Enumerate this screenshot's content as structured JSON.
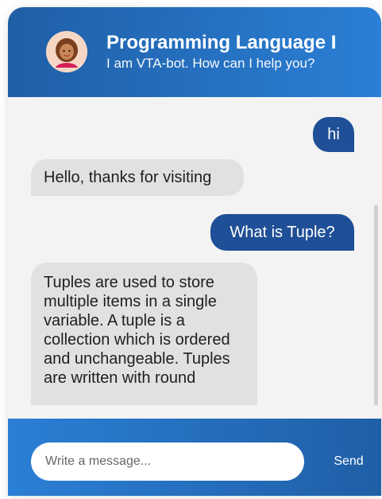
{
  "header": {
    "title": "Programming Language I",
    "subtitle": "I am VTA-bot. How can I help you?"
  },
  "messages": [
    {
      "sender": "user",
      "text": "hi"
    },
    {
      "sender": "bot",
      "text": "Hello, thanks for visiting"
    },
    {
      "sender": "user",
      "text": "What is Tuple?"
    },
    {
      "sender": "bot",
      "text": "Tuples are used to store multiple items in a single variable. A tuple is a collection which is ordered and unchangeable. Tuples are written with round"
    }
  ],
  "composer": {
    "placeholder": "Write a message...",
    "send_label": "Send"
  },
  "colors": {
    "header_gradient_start": "#1f5fa6",
    "header_gradient_end": "#2b7fd6",
    "user_bubble": "#1f4f96",
    "bot_bubble": "#e1e1e1",
    "chat_background": "#f3f3f3"
  },
  "icons": {
    "avatar": "bot-avatar-icon"
  }
}
